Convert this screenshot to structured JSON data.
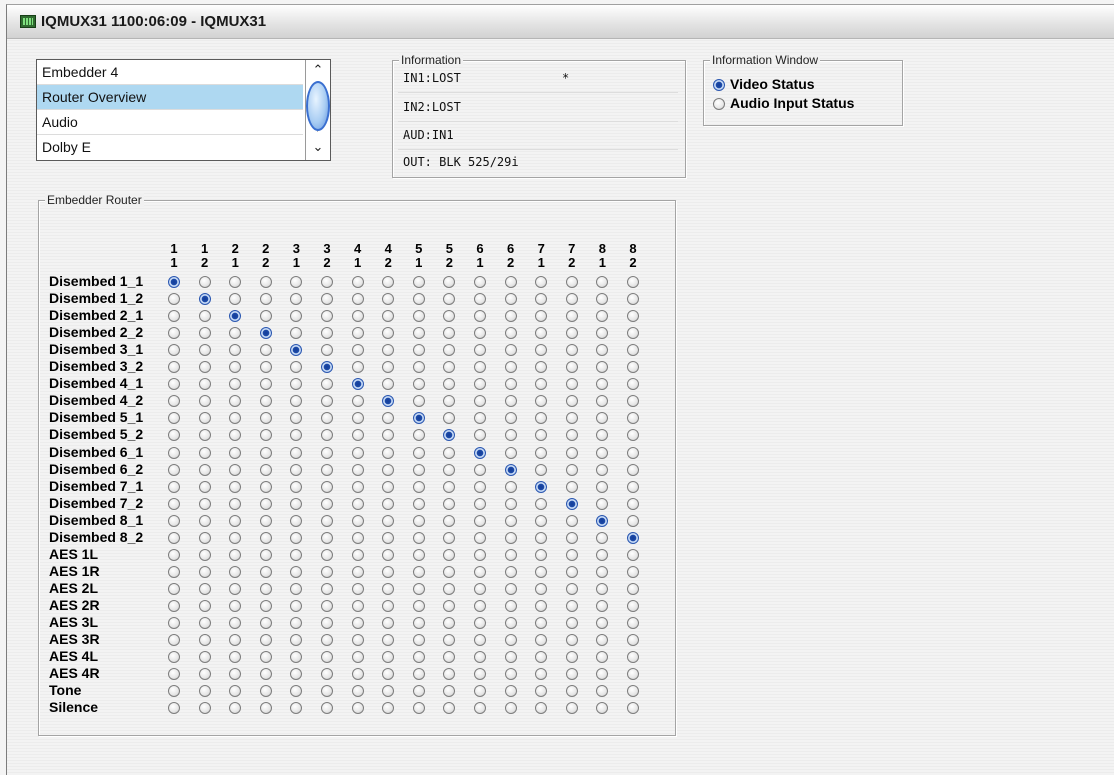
{
  "window": {
    "title": "IQMUX31  1100:06:09  - IQMUX31"
  },
  "page_list": {
    "items": [
      "Embedder 4",
      "Router Overview",
      "Audio",
      "Dolby E"
    ],
    "selected_index": 1,
    "scroll_up": "⌃",
    "scroll_down": "⌄"
  },
  "information": {
    "title": "Information",
    "lines": [
      "IN1:LOST              *",
      "IN2:LOST",
      "AUD:IN1",
      "OUT: BLK 525/29i"
    ]
  },
  "information_window": {
    "title": "Information Window",
    "options": [
      "Video Status",
      "Audio Input Status"
    ],
    "selected_index": 0
  },
  "router": {
    "title": "Embedder Router",
    "columns": [
      [
        "1",
        "1"
      ],
      [
        "1",
        "2"
      ],
      [
        "2",
        "1"
      ],
      [
        "2",
        "2"
      ],
      [
        "3",
        "1"
      ],
      [
        "3",
        "2"
      ],
      [
        "4",
        "1"
      ],
      [
        "4",
        "2"
      ],
      [
        "5",
        "1"
      ],
      [
        "5",
        "2"
      ],
      [
        "6",
        "1"
      ],
      [
        "6",
        "2"
      ],
      [
        "7",
        "1"
      ],
      [
        "7",
        "2"
      ],
      [
        "8",
        "1"
      ],
      [
        "8",
        "2"
      ]
    ],
    "rows": [
      "Disembed 1_1",
      "Disembed 1_2",
      "Disembed 2_1",
      "Disembed 2_2",
      "Disembed 3_1",
      "Disembed 3_2",
      "Disembed 4_1",
      "Disembed 4_2",
      "Disembed 5_1",
      "Disembed 5_2",
      "Disembed 6_1",
      "Disembed 6_2",
      "Disembed 7_1",
      "Disembed 7_2",
      "Disembed 8_1",
      "Disembed 8_2",
      "AES 1L",
      "AES 1R",
      "AES 2L",
      "AES 2R",
      "AES 3L",
      "AES 3R",
      "AES 4L",
      "AES 4R",
      "Tone",
      "Silence"
    ],
    "selected_row_for_column": [
      0,
      1,
      2,
      3,
      4,
      5,
      6,
      7,
      8,
      9,
      10,
      11,
      12,
      13,
      14,
      15
    ]
  }
}
